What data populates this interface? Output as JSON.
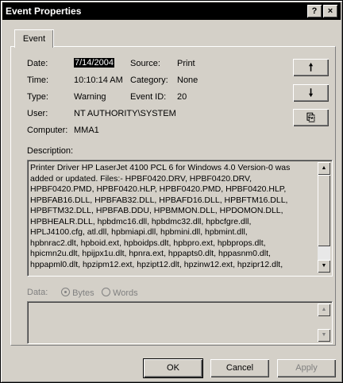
{
  "window": {
    "title": "Event Properties",
    "help": "?",
    "close": "×"
  },
  "tab": {
    "label": "Event"
  },
  "fields": {
    "date_label": "Date:",
    "date_value": "7/14/2004",
    "source_label": "Source:",
    "source_value": "Print",
    "time_label": "Time:",
    "time_value": "10:10:14 AM",
    "category_label": "Category:",
    "category_value": "None",
    "type_label": "Type:",
    "type_value": "Warning",
    "eventid_label": "Event ID:",
    "eventid_value": "20",
    "user_label": "User:",
    "user_value": "NT AUTHORITY\\SYSTEM",
    "computer_label": "Computer:",
    "computer_value": "MMA1"
  },
  "nav": {
    "up": "🠕",
    "down": "🠗",
    "copy": "⎘"
  },
  "description": {
    "label": "Description:",
    "text": "Printer Driver HP LaserJet 4100 PCL 6 for Windows 4.0 Version-0 was\nadded or updated. Files:- HPBF0420.DRV, HPBF0420.DRV,\nHPBF0420.PMD, HPBF0420.HLP, HPBF0420.PMD, HPBF0420.HLP,\nHPBFAB16.DLL, HPBFAB32.DLL, HPBAFD16.DLL, HPBFTM16.DLL,\nHPBFTM32.DLL, HPBFAB.DDU, HPBMMON.DLL, HPDOMON.DLL,\nHPBHEALR.DLL, hpbdmc16.dll, hpbdmc32.dll, hpbcfgre.dll,\nHPLJ4100.cfg, atl.dll, hpbmiapi.dll, hpbmini.dll, hpbmint.dll,\nhpbnrac2.dlt, hpboid.ext, hpboidps.dlt, hpbpro.ext, hpbprops.dlt,\nhpicmn2u.dlt, hpijpx1u.dlt, hpnra.ext, hppapts0.dlt, hppasnm0.dlt,\nhppapml0.dlt, hpzipm12.ext, hpzipt12.dlt, hpzinw12.ext, hpzipr12.dlt,"
  },
  "data_section": {
    "label": "Data:",
    "bytes": "Bytes",
    "words": "Words"
  },
  "buttons": {
    "ok": "OK",
    "cancel": "Cancel",
    "apply": "Apply"
  }
}
